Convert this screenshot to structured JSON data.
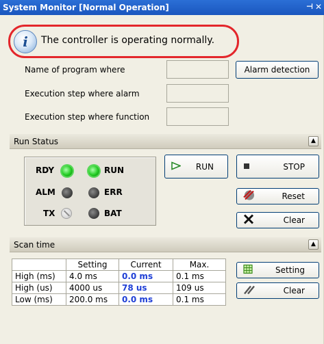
{
  "window": {
    "title": "System Monitor [Normal Operation]",
    "pin_glyph": "⊣",
    "close_glyph": "✕"
  },
  "info": {
    "message": "The controller is operating normally.",
    "icon": "info-icon"
  },
  "program": {
    "name_label": "Name of program where",
    "alarm_step_label": "Execution step where alarm",
    "function_step_label": "Execution step where function",
    "alarm_detection_button": "Alarm detection"
  },
  "run_status": {
    "header": "Run Status",
    "leds": {
      "rdy": {
        "label": "RDY",
        "state": "green"
      },
      "run": {
        "label": "RUN",
        "state": "green"
      },
      "alm": {
        "label": "ALM",
        "state": "off"
      },
      "err": {
        "label": "ERR",
        "state": "off"
      },
      "tx": {
        "label": "TX",
        "state": "disabled"
      },
      "bat": {
        "label": "BAT",
        "state": "off"
      }
    },
    "buttons": {
      "run": "RUN",
      "stop": "STOP",
      "reset": "Reset",
      "clear": "Clear"
    }
  },
  "scan_time": {
    "header": "Scan time",
    "columns": [
      "",
      "Setting",
      "Current",
      "Max."
    ],
    "rows": [
      {
        "label": "High (ms)",
        "setting": "4.0 ms",
        "current": "0.0 ms",
        "max": "0.1 ms"
      },
      {
        "label": "High (us)",
        "setting": "4000 us",
        "current": "78 us",
        "max": "109 us"
      },
      {
        "label": "Low (ms)",
        "setting": "200.0 ms",
        "current": "0.0 ms",
        "max": "0.1 ms"
      }
    ],
    "buttons": {
      "setting": "Setting",
      "clear": "Clear"
    }
  },
  "colors": {
    "titlebar": "#1a56be",
    "highlight_ring": "#e3262b",
    "current_value": "#1f3fd6",
    "led_on": "#22cc22"
  }
}
